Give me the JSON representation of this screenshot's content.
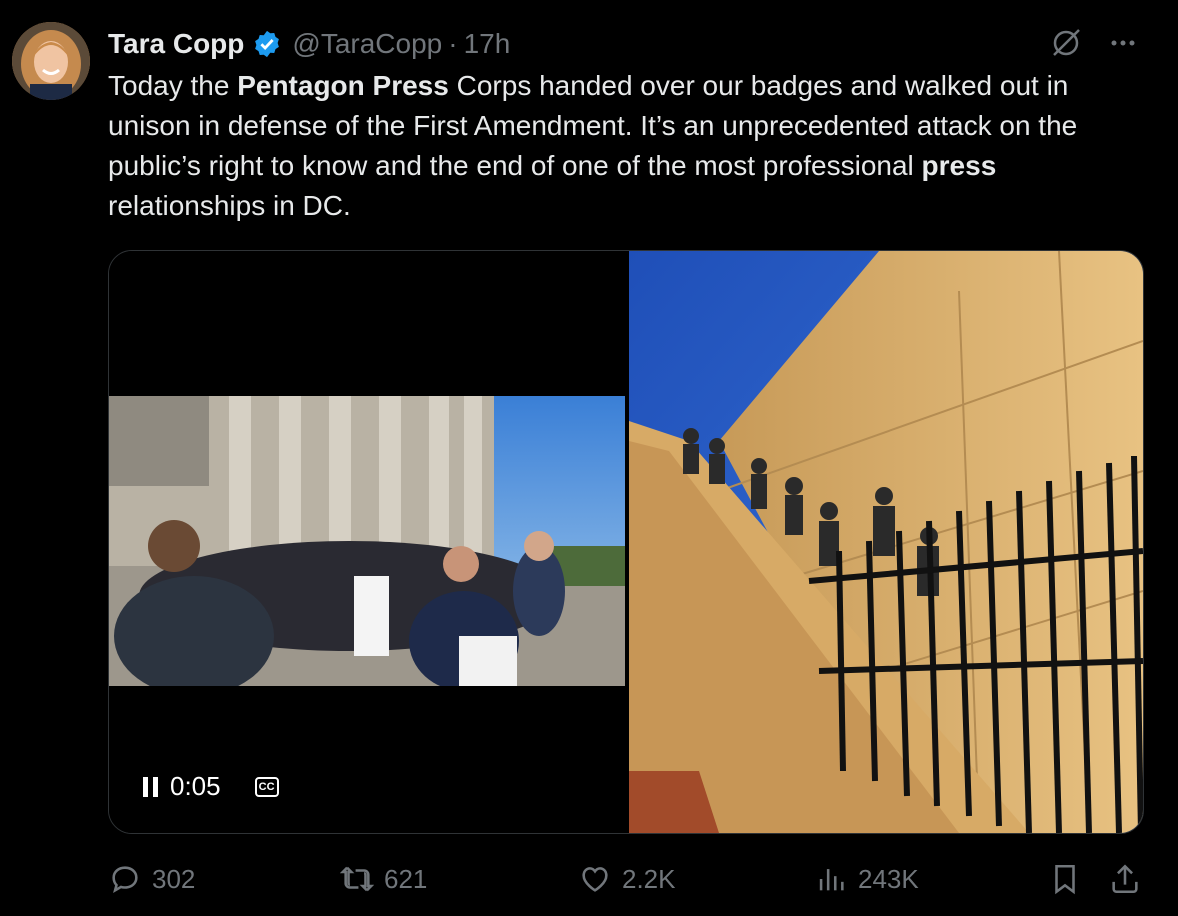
{
  "author": {
    "name": "Tara Copp",
    "handle": "@TaraCopp",
    "separator": "·",
    "time": "17h",
    "verified": true
  },
  "tweet": {
    "segments": [
      {
        "text": "Today the ",
        "bold": false
      },
      {
        "text": "Pentagon Press",
        "bold": true
      },
      {
        "text": " Corps handed over our badges and walked out in unison in defense of the First Amendment. It’s an unprecedented attack on the public’s right to know and the end of one of the most professional ",
        "bold": false
      },
      {
        "text": "press",
        "bold": true
      },
      {
        "text": " relationships in DC.",
        "bold": false
      }
    ]
  },
  "media": {
    "video": {
      "time": "0:05",
      "cc_label": "CC",
      "state": "playing"
    },
    "photo": {
      "alt": ""
    }
  },
  "actions": {
    "replies": "302",
    "reposts": "621",
    "likes": "2.2K",
    "views": "243K"
  },
  "colors": {
    "background": "#000000",
    "text": "#e7e9ea",
    "muted": "#71767b",
    "verified": "#1d9bf0"
  },
  "icons": [
    "grok-icon",
    "more-icon",
    "verified-badge-icon",
    "pause-icon",
    "closed-captions-icon",
    "reply-icon",
    "repost-icon",
    "like-icon",
    "views-icon",
    "bookmark-icon",
    "share-icon"
  ]
}
